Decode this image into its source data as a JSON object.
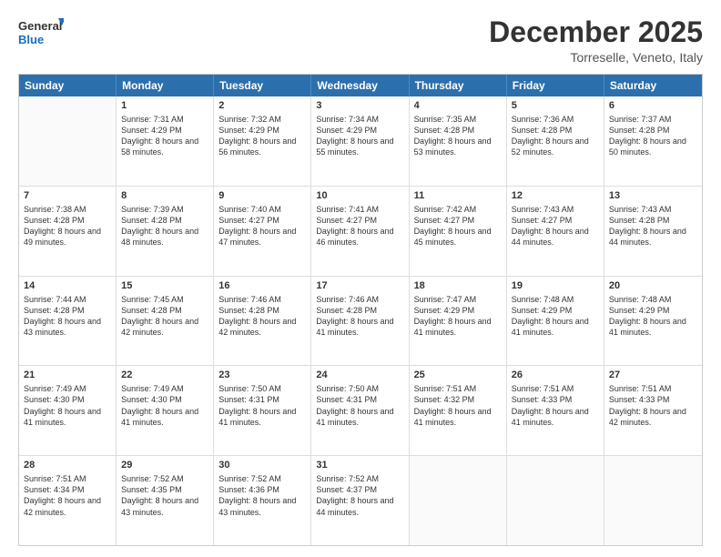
{
  "logo": {
    "line1": "General",
    "line2": "Blue"
  },
  "header": {
    "month": "December 2025",
    "location": "Torreselle, Veneto, Italy"
  },
  "weekdays": [
    "Sunday",
    "Monday",
    "Tuesday",
    "Wednesday",
    "Thursday",
    "Friday",
    "Saturday"
  ],
  "weeks": [
    [
      {
        "day": "",
        "sunrise": "",
        "sunset": "",
        "daylight": ""
      },
      {
        "day": "1",
        "sunrise": "Sunrise: 7:31 AM",
        "sunset": "Sunset: 4:29 PM",
        "daylight": "Daylight: 8 hours and 58 minutes."
      },
      {
        "day": "2",
        "sunrise": "Sunrise: 7:32 AM",
        "sunset": "Sunset: 4:29 PM",
        "daylight": "Daylight: 8 hours and 56 minutes."
      },
      {
        "day": "3",
        "sunrise": "Sunrise: 7:34 AM",
        "sunset": "Sunset: 4:29 PM",
        "daylight": "Daylight: 8 hours and 55 minutes."
      },
      {
        "day": "4",
        "sunrise": "Sunrise: 7:35 AM",
        "sunset": "Sunset: 4:28 PM",
        "daylight": "Daylight: 8 hours and 53 minutes."
      },
      {
        "day": "5",
        "sunrise": "Sunrise: 7:36 AM",
        "sunset": "Sunset: 4:28 PM",
        "daylight": "Daylight: 8 hours and 52 minutes."
      },
      {
        "day": "6",
        "sunrise": "Sunrise: 7:37 AM",
        "sunset": "Sunset: 4:28 PM",
        "daylight": "Daylight: 8 hours and 50 minutes."
      }
    ],
    [
      {
        "day": "7",
        "sunrise": "Sunrise: 7:38 AM",
        "sunset": "Sunset: 4:28 PM",
        "daylight": "Daylight: 8 hours and 49 minutes."
      },
      {
        "day": "8",
        "sunrise": "Sunrise: 7:39 AM",
        "sunset": "Sunset: 4:28 PM",
        "daylight": "Daylight: 8 hours and 48 minutes."
      },
      {
        "day": "9",
        "sunrise": "Sunrise: 7:40 AM",
        "sunset": "Sunset: 4:27 PM",
        "daylight": "Daylight: 8 hours and 47 minutes."
      },
      {
        "day": "10",
        "sunrise": "Sunrise: 7:41 AM",
        "sunset": "Sunset: 4:27 PM",
        "daylight": "Daylight: 8 hours and 46 minutes."
      },
      {
        "day": "11",
        "sunrise": "Sunrise: 7:42 AM",
        "sunset": "Sunset: 4:27 PM",
        "daylight": "Daylight: 8 hours and 45 minutes."
      },
      {
        "day": "12",
        "sunrise": "Sunrise: 7:43 AM",
        "sunset": "Sunset: 4:27 PM",
        "daylight": "Daylight: 8 hours and 44 minutes."
      },
      {
        "day": "13",
        "sunrise": "Sunrise: 7:43 AM",
        "sunset": "Sunset: 4:28 PM",
        "daylight": "Daylight: 8 hours and 44 minutes."
      }
    ],
    [
      {
        "day": "14",
        "sunrise": "Sunrise: 7:44 AM",
        "sunset": "Sunset: 4:28 PM",
        "daylight": "Daylight: 8 hours and 43 minutes."
      },
      {
        "day": "15",
        "sunrise": "Sunrise: 7:45 AM",
        "sunset": "Sunset: 4:28 PM",
        "daylight": "Daylight: 8 hours and 42 minutes."
      },
      {
        "day": "16",
        "sunrise": "Sunrise: 7:46 AM",
        "sunset": "Sunset: 4:28 PM",
        "daylight": "Daylight: 8 hours and 42 minutes."
      },
      {
        "day": "17",
        "sunrise": "Sunrise: 7:46 AM",
        "sunset": "Sunset: 4:28 PM",
        "daylight": "Daylight: 8 hours and 41 minutes."
      },
      {
        "day": "18",
        "sunrise": "Sunrise: 7:47 AM",
        "sunset": "Sunset: 4:29 PM",
        "daylight": "Daylight: 8 hours and 41 minutes."
      },
      {
        "day": "19",
        "sunrise": "Sunrise: 7:48 AM",
        "sunset": "Sunset: 4:29 PM",
        "daylight": "Daylight: 8 hours and 41 minutes."
      },
      {
        "day": "20",
        "sunrise": "Sunrise: 7:48 AM",
        "sunset": "Sunset: 4:29 PM",
        "daylight": "Daylight: 8 hours and 41 minutes."
      }
    ],
    [
      {
        "day": "21",
        "sunrise": "Sunrise: 7:49 AM",
        "sunset": "Sunset: 4:30 PM",
        "daylight": "Daylight: 8 hours and 41 minutes."
      },
      {
        "day": "22",
        "sunrise": "Sunrise: 7:49 AM",
        "sunset": "Sunset: 4:30 PM",
        "daylight": "Daylight: 8 hours and 41 minutes."
      },
      {
        "day": "23",
        "sunrise": "Sunrise: 7:50 AM",
        "sunset": "Sunset: 4:31 PM",
        "daylight": "Daylight: 8 hours and 41 minutes."
      },
      {
        "day": "24",
        "sunrise": "Sunrise: 7:50 AM",
        "sunset": "Sunset: 4:31 PM",
        "daylight": "Daylight: 8 hours and 41 minutes."
      },
      {
        "day": "25",
        "sunrise": "Sunrise: 7:51 AM",
        "sunset": "Sunset: 4:32 PM",
        "daylight": "Daylight: 8 hours and 41 minutes."
      },
      {
        "day": "26",
        "sunrise": "Sunrise: 7:51 AM",
        "sunset": "Sunset: 4:33 PM",
        "daylight": "Daylight: 8 hours and 41 minutes."
      },
      {
        "day": "27",
        "sunrise": "Sunrise: 7:51 AM",
        "sunset": "Sunset: 4:33 PM",
        "daylight": "Daylight: 8 hours and 42 minutes."
      }
    ],
    [
      {
        "day": "28",
        "sunrise": "Sunrise: 7:51 AM",
        "sunset": "Sunset: 4:34 PM",
        "daylight": "Daylight: 8 hours and 42 minutes."
      },
      {
        "day": "29",
        "sunrise": "Sunrise: 7:52 AM",
        "sunset": "Sunset: 4:35 PM",
        "daylight": "Daylight: 8 hours and 43 minutes."
      },
      {
        "day": "30",
        "sunrise": "Sunrise: 7:52 AM",
        "sunset": "Sunset: 4:36 PM",
        "daylight": "Daylight: 8 hours and 43 minutes."
      },
      {
        "day": "31",
        "sunrise": "Sunrise: 7:52 AM",
        "sunset": "Sunset: 4:37 PM",
        "daylight": "Daylight: 8 hours and 44 minutes."
      },
      {
        "day": "",
        "sunrise": "",
        "sunset": "",
        "daylight": ""
      },
      {
        "day": "",
        "sunrise": "",
        "sunset": "",
        "daylight": ""
      },
      {
        "day": "",
        "sunrise": "",
        "sunset": "",
        "daylight": ""
      }
    ]
  ]
}
